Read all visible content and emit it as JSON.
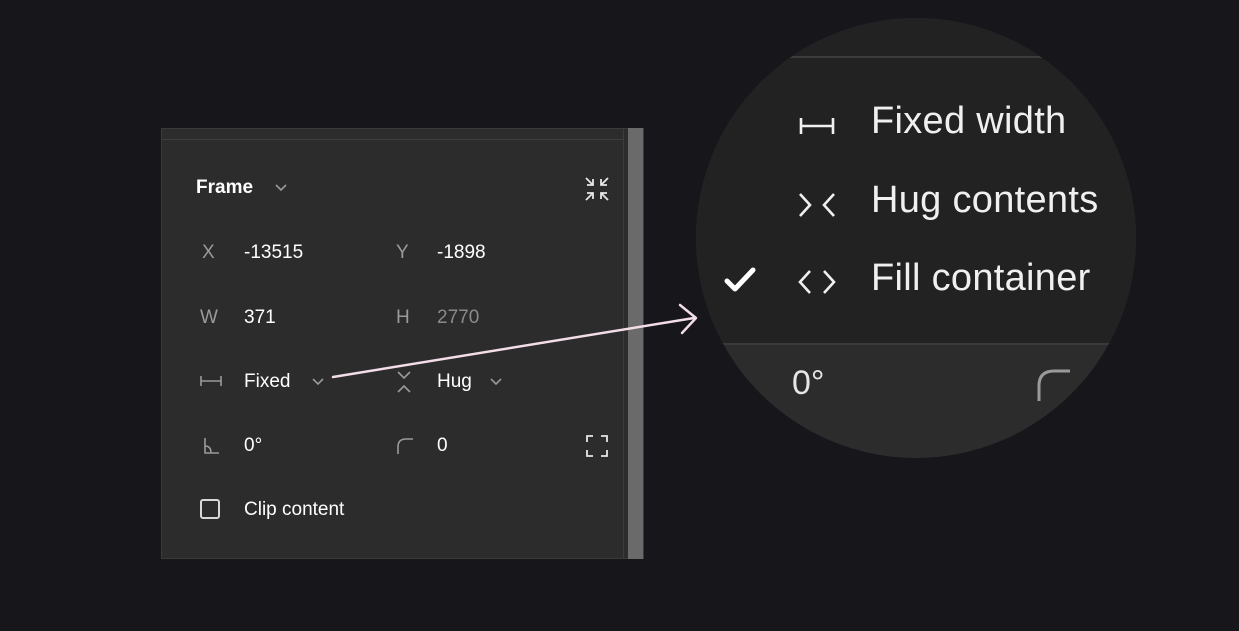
{
  "panel": {
    "title": "Frame",
    "x_label": "X",
    "x_value": "-13515",
    "y_label": "Y",
    "y_value": "-1898",
    "w_label": "W",
    "w_value": "371",
    "h_label": "H",
    "h_value": "2770",
    "width_mode": "Fixed",
    "height_mode": "Hug",
    "rotation": "0°",
    "corner_radius": "0",
    "clip_content": "Clip content"
  },
  "magnifier": {
    "items": [
      {
        "label": "Fixed width",
        "icon": "fixed-width-icon",
        "checked": false
      },
      {
        "label": "Hug contents",
        "icon": "hug-contents-icon",
        "checked": false
      },
      {
        "label": "Fill container",
        "icon": "fill-container-icon",
        "checked": true
      }
    ],
    "rotation": "0°"
  },
  "colors": {
    "background": "#16161b",
    "panel": "#2c2c2c",
    "menu": "#222222",
    "arrow": "#f2dde8"
  }
}
